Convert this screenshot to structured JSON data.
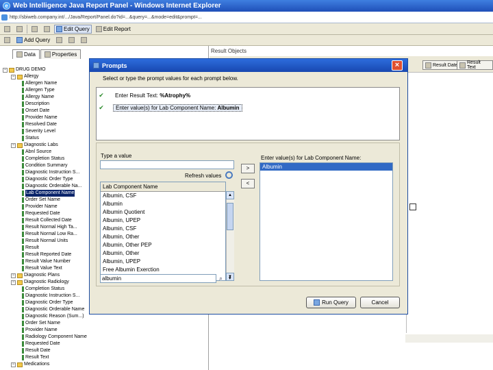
{
  "window": {
    "title": "Web Intelligence Java Report Panel - Windows Internet Explorer"
  },
  "address": {
    "url": "http://sbiweb.company.int/.../Java/Report/Panel.do?id=...&query=...&mode=edit&prompt=..."
  },
  "toolbar": {
    "edit_query": "Edit Query",
    "edit_report": "Edit Report"
  },
  "toolbar2": {
    "add_query": "Add Query"
  },
  "left": {
    "tabs": [
      "Data",
      "Properties"
    ],
    "tree": [
      {
        "level": 1,
        "type": "root",
        "label": "DRUG DEMO"
      },
      {
        "level": 2,
        "type": "folder",
        "label": "Allergy"
      },
      {
        "level": 3,
        "type": "obj",
        "label": "Allergen Name"
      },
      {
        "level": 3,
        "type": "obj",
        "label": "Allergen Type"
      },
      {
        "level": 3,
        "type": "obj",
        "label": "Allergy Name"
      },
      {
        "level": 3,
        "type": "obj",
        "label": "Description"
      },
      {
        "level": 3,
        "type": "obj",
        "label": "Onset Date"
      },
      {
        "level": 3,
        "type": "obj",
        "label": "Provider Name"
      },
      {
        "level": 3,
        "type": "obj",
        "label": "Resolved Date"
      },
      {
        "level": 3,
        "type": "obj",
        "label": "Severity Level"
      },
      {
        "level": 3,
        "type": "obj",
        "label": "Status"
      },
      {
        "level": 2,
        "type": "folder",
        "label": "Diagnostic Labs"
      },
      {
        "level": 3,
        "type": "obj",
        "label": "Abnl Source"
      },
      {
        "level": 3,
        "type": "obj",
        "label": "Completion Status"
      },
      {
        "level": 3,
        "type": "obj",
        "label": "Condition Summary"
      },
      {
        "level": 3,
        "type": "obj",
        "label": "Diagnostic Instruction S..."
      },
      {
        "level": 3,
        "type": "obj",
        "label": "Diagnostic Order Type"
      },
      {
        "level": 3,
        "type": "obj",
        "label": "Diagnostic Orderable Na..."
      },
      {
        "level": 3,
        "type": "obj",
        "label": "Lab Component Name",
        "selected": true
      },
      {
        "level": 3,
        "type": "obj",
        "label": "Order Set Name"
      },
      {
        "level": 3,
        "type": "obj",
        "label": "Provider Name"
      },
      {
        "level": 3,
        "type": "obj",
        "label": "Requested Date"
      },
      {
        "level": 3,
        "type": "obj",
        "label": "Result Collected Date"
      },
      {
        "level": 3,
        "type": "obj",
        "label": "Result Normal High Ta..."
      },
      {
        "level": 3,
        "type": "obj",
        "label": "Result Normal Low Ra..."
      },
      {
        "level": 3,
        "type": "obj",
        "label": "Result Normal Units"
      },
      {
        "level": 3,
        "type": "obj",
        "label": "Result"
      },
      {
        "level": 3,
        "type": "obj",
        "label": "Result Reported Date"
      },
      {
        "level": 3,
        "type": "obj",
        "label": "Result Value Number"
      },
      {
        "level": 3,
        "type": "obj",
        "label": "Result Value Text"
      },
      {
        "level": 2,
        "type": "folder",
        "label": "Diagnostic Plans"
      },
      {
        "level": 2,
        "type": "folder",
        "label": "Diagnostic Radiology"
      },
      {
        "level": 3,
        "type": "obj",
        "label": "Completion Status"
      },
      {
        "level": 3,
        "type": "obj",
        "label": "Diagnostic Instruction S..."
      },
      {
        "level": 3,
        "type": "obj",
        "label": "Diagnostic Order Type"
      },
      {
        "level": 3,
        "type": "obj",
        "label": "Diagnostic Orderable Name"
      },
      {
        "level": 3,
        "type": "obj",
        "label": "Diagnostic Reason (Sum...)"
      },
      {
        "level": 3,
        "type": "obj",
        "label": "Order Set Name"
      },
      {
        "level": 3,
        "type": "obj",
        "label": "Provider Name"
      },
      {
        "level": 3,
        "type": "obj",
        "label": "Radiology Component Name"
      },
      {
        "level": 3,
        "type": "obj",
        "label": "Requested Date"
      },
      {
        "level": 3,
        "type": "obj",
        "label": "Result Date"
      },
      {
        "level": 3,
        "type": "obj",
        "label": "Result Text"
      },
      {
        "level": 2,
        "type": "folder",
        "label": "Medications"
      }
    ]
  },
  "right": {
    "header": "Result Objects",
    "buttons": [
      "Result Date",
      "Result Text"
    ]
  },
  "dialog": {
    "title": "Prompts",
    "instruction": "Select or type the prompt values for each prompt below.",
    "prompts": [
      {
        "label": "Enter Result Text:",
        "value": "%Atrophy%"
      },
      {
        "label": "Enter value(s) for Lab Component Name:",
        "value": "Albumin"
      }
    ],
    "type_label": "Type a value",
    "refresh_label": "Refresh values",
    "lov_header": "Lab Component Name",
    "lov_items": [
      "Albumin, CSF",
      "Albumin",
      "Albumin Quotient",
      "Albumin, UPEP",
      "Albumin, CSF",
      "Albumin, Other",
      "Albumin, Other PEP",
      "Albumin, Other",
      "Albumin, UPEP",
      "Free Albumin Exerction"
    ],
    "search_value": "albumin",
    "selected_label": "Enter value(s) for Lab Component Name:",
    "selected_values": [
      "Albumin"
    ],
    "add_arrow": ">",
    "remove_arrow": "<",
    "run_query": "Run Query",
    "cancel": "Cancel"
  }
}
